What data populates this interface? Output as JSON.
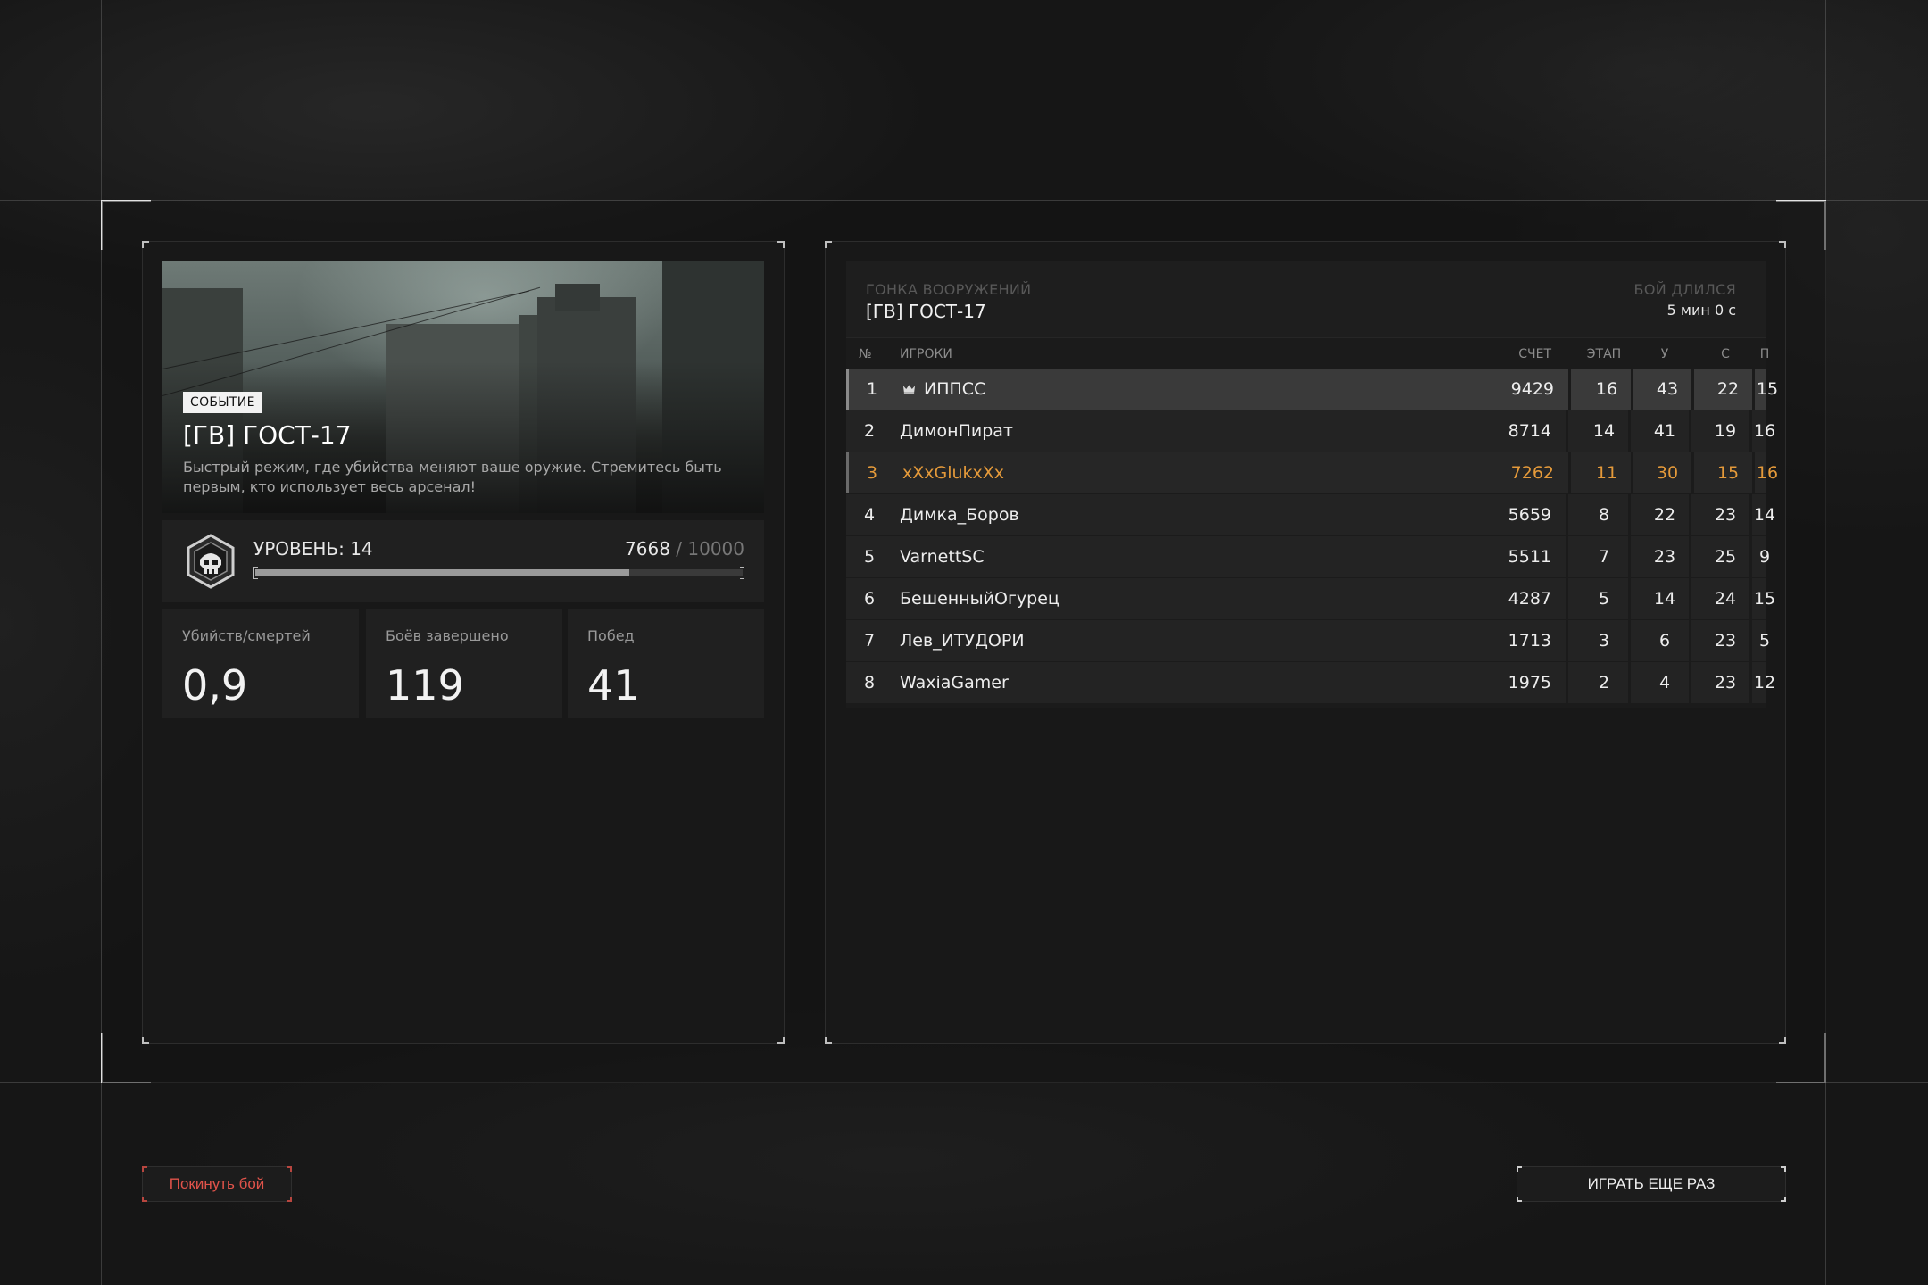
{
  "event": {
    "badge": "СОБЫТИЕ",
    "title": "[ГВ] ГОСТ-17",
    "description": "Быстрый режим, где убийства меняют ваше оружие. Стремитесь быть первым, кто использует весь арсенал!"
  },
  "level": {
    "label": "УРОВЕНЬ: 14",
    "xp_current": "7668",
    "xp_separator": " / ",
    "xp_max": "10000",
    "xp_progress": 0.7668,
    "icon": "skull-shield-icon"
  },
  "stats": [
    {
      "label": "Убийств/смертей",
      "value": "0,9"
    },
    {
      "label": "Боёв завершено",
      "value": "119"
    },
    {
      "label": "Побед",
      "value": "41"
    }
  ],
  "scoreboard": {
    "mode_label": "ГОНКА ВООРУЖЕНИЙ",
    "map_name": "[ГВ] ГОСТ-17",
    "duration_label": "БОЙ ДЛИЛСЯ",
    "duration_value": "5 мин 0 с",
    "columns": {
      "num": "№",
      "players": "ИГРОКИ",
      "score": "СЧЕТ",
      "stage": "ЭТАП",
      "kills": "У",
      "deaths": "С",
      "assists": "П"
    },
    "rows": [
      {
        "num": "1",
        "name": "ИППСС",
        "score": "9429",
        "stage": "16",
        "kills": "43",
        "deaths": "22",
        "assists": "15"
      },
      {
        "num": "2",
        "name": "ДимонПират",
        "score": "8714",
        "stage": "14",
        "kills": "41",
        "deaths": "19",
        "assists": "16"
      },
      {
        "num": "3",
        "name": "xXxGlukxXx",
        "score": "7262",
        "stage": "11",
        "kills": "30",
        "deaths": "15",
        "assists": "16"
      },
      {
        "num": "4",
        "name": "Димка_Боров",
        "score": "5659",
        "stage": "8",
        "kills": "22",
        "deaths": "23",
        "assists": "14"
      },
      {
        "num": "5",
        "name": "VarnettSC",
        "score": "5511",
        "stage": "7",
        "kills": "23",
        "deaths": "25",
        "assists": "9"
      },
      {
        "num": "6",
        "name": "БешенныйОгурец",
        "score": "4287",
        "stage": "5",
        "kills": "14",
        "deaths": "24",
        "assists": "15"
      },
      {
        "num": "7",
        "name": "Лев_ИТУДОРИ",
        "score": "1713",
        "stage": "3",
        "kills": "6",
        "deaths": "23",
        "assists": "5"
      },
      {
        "num": "8",
        "name": "WaxiaGamer",
        "score": "1975",
        "stage": "2",
        "kills": "4",
        "deaths": "23",
        "assists": "12"
      }
    ],
    "leader_icon": "crown-icon",
    "highlight_color": "#e59a3a"
  },
  "buttons": {
    "leave": "Покинуть бой",
    "play_again": "ИГРАТЬ ЕЩЕ РАЗ"
  }
}
